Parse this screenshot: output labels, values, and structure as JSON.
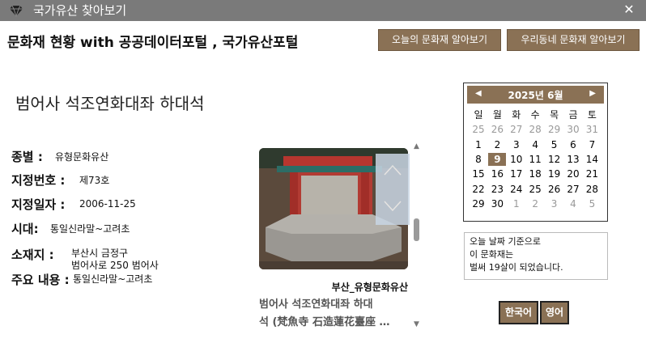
{
  "window": {
    "title": "국가유산 찾아보기",
    "close_symbol": "✕"
  },
  "header": {
    "title": "문화재 현황 with 공공데이터포털 , 국가유산포털",
    "today_button": "오늘의 문화재 알아보기",
    "neighborhood_button": "우리동네 문화재 알아보기"
  },
  "heritage": {
    "name": "범어사 석조연화대좌 하대석",
    "fields": [
      {
        "label": "종별 :",
        "value": "유형문화유산"
      },
      {
        "label": "지정번호 :",
        "value": "제73호"
      },
      {
        "label": "지정일자 :",
        "value": "2006-11-25"
      },
      {
        "label": "시대:",
        "value": "통일신라말~고려초"
      },
      {
        "label": "소재지 :",
        "value_line1": "부산시 금정구",
        "value_line2": "범어사로 250 범어사"
      },
      {
        "label": "주요 내용 :",
        "value": "통일신라말~고려초"
      }
    ]
  },
  "gallery": {
    "category": "부산_유형문화유산",
    "caption_line1": "범어사 석조연화대좌 하대",
    "caption_line2": "석 (梵魚寺 石造蓮花臺座 …"
  },
  "calendar": {
    "month_label": "2025년 6월",
    "weekdays": [
      "일",
      "월",
      "화",
      "수",
      "목",
      "금",
      "토"
    ],
    "weeks": [
      [
        {
          "d": "25",
          "dim": true
        },
        {
          "d": "26",
          "dim": true
        },
        {
          "d": "27",
          "dim": true
        },
        {
          "d": "28",
          "dim": true
        },
        {
          "d": "29",
          "dim": true
        },
        {
          "d": "30",
          "dim": true
        },
        {
          "d": "31",
          "dim": true
        }
      ],
      [
        {
          "d": "1"
        },
        {
          "d": "2"
        },
        {
          "d": "3"
        },
        {
          "d": "4"
        },
        {
          "d": "5"
        },
        {
          "d": "6"
        },
        {
          "d": "7"
        }
      ],
      [
        {
          "d": "8"
        },
        {
          "d": "9",
          "today": true
        },
        {
          "d": "10"
        },
        {
          "d": "11"
        },
        {
          "d": "12"
        },
        {
          "d": "13"
        },
        {
          "d": "14"
        }
      ],
      [
        {
          "d": "15"
        },
        {
          "d": "16"
        },
        {
          "d": "17"
        },
        {
          "d": "18"
        },
        {
          "d": "19"
        },
        {
          "d": "20"
        },
        {
          "d": "21"
        }
      ],
      [
        {
          "d": "22"
        },
        {
          "d": "23"
        },
        {
          "d": "24"
        },
        {
          "d": "25"
        },
        {
          "d": "26"
        },
        {
          "d": "27"
        },
        {
          "d": "28"
        }
      ],
      [
        {
          "d": "29"
        },
        {
          "d": "30"
        },
        {
          "d": "1",
          "dim": true
        },
        {
          "d": "2",
          "dim": true
        },
        {
          "d": "3",
          "dim": true
        },
        {
          "d": "4",
          "dim": true
        },
        {
          "d": "5",
          "dim": true
        }
      ]
    ]
  },
  "age_info": {
    "line1": "오늘 날짜 기준으로",
    "line2": "이 문화재는",
    "line3": "벌써 19살이 되었습니다."
  },
  "language": {
    "korean": "한국어",
    "english": "영어"
  },
  "colors": {
    "accent": "#8a7155",
    "titlebar": "#7a7a7a"
  }
}
